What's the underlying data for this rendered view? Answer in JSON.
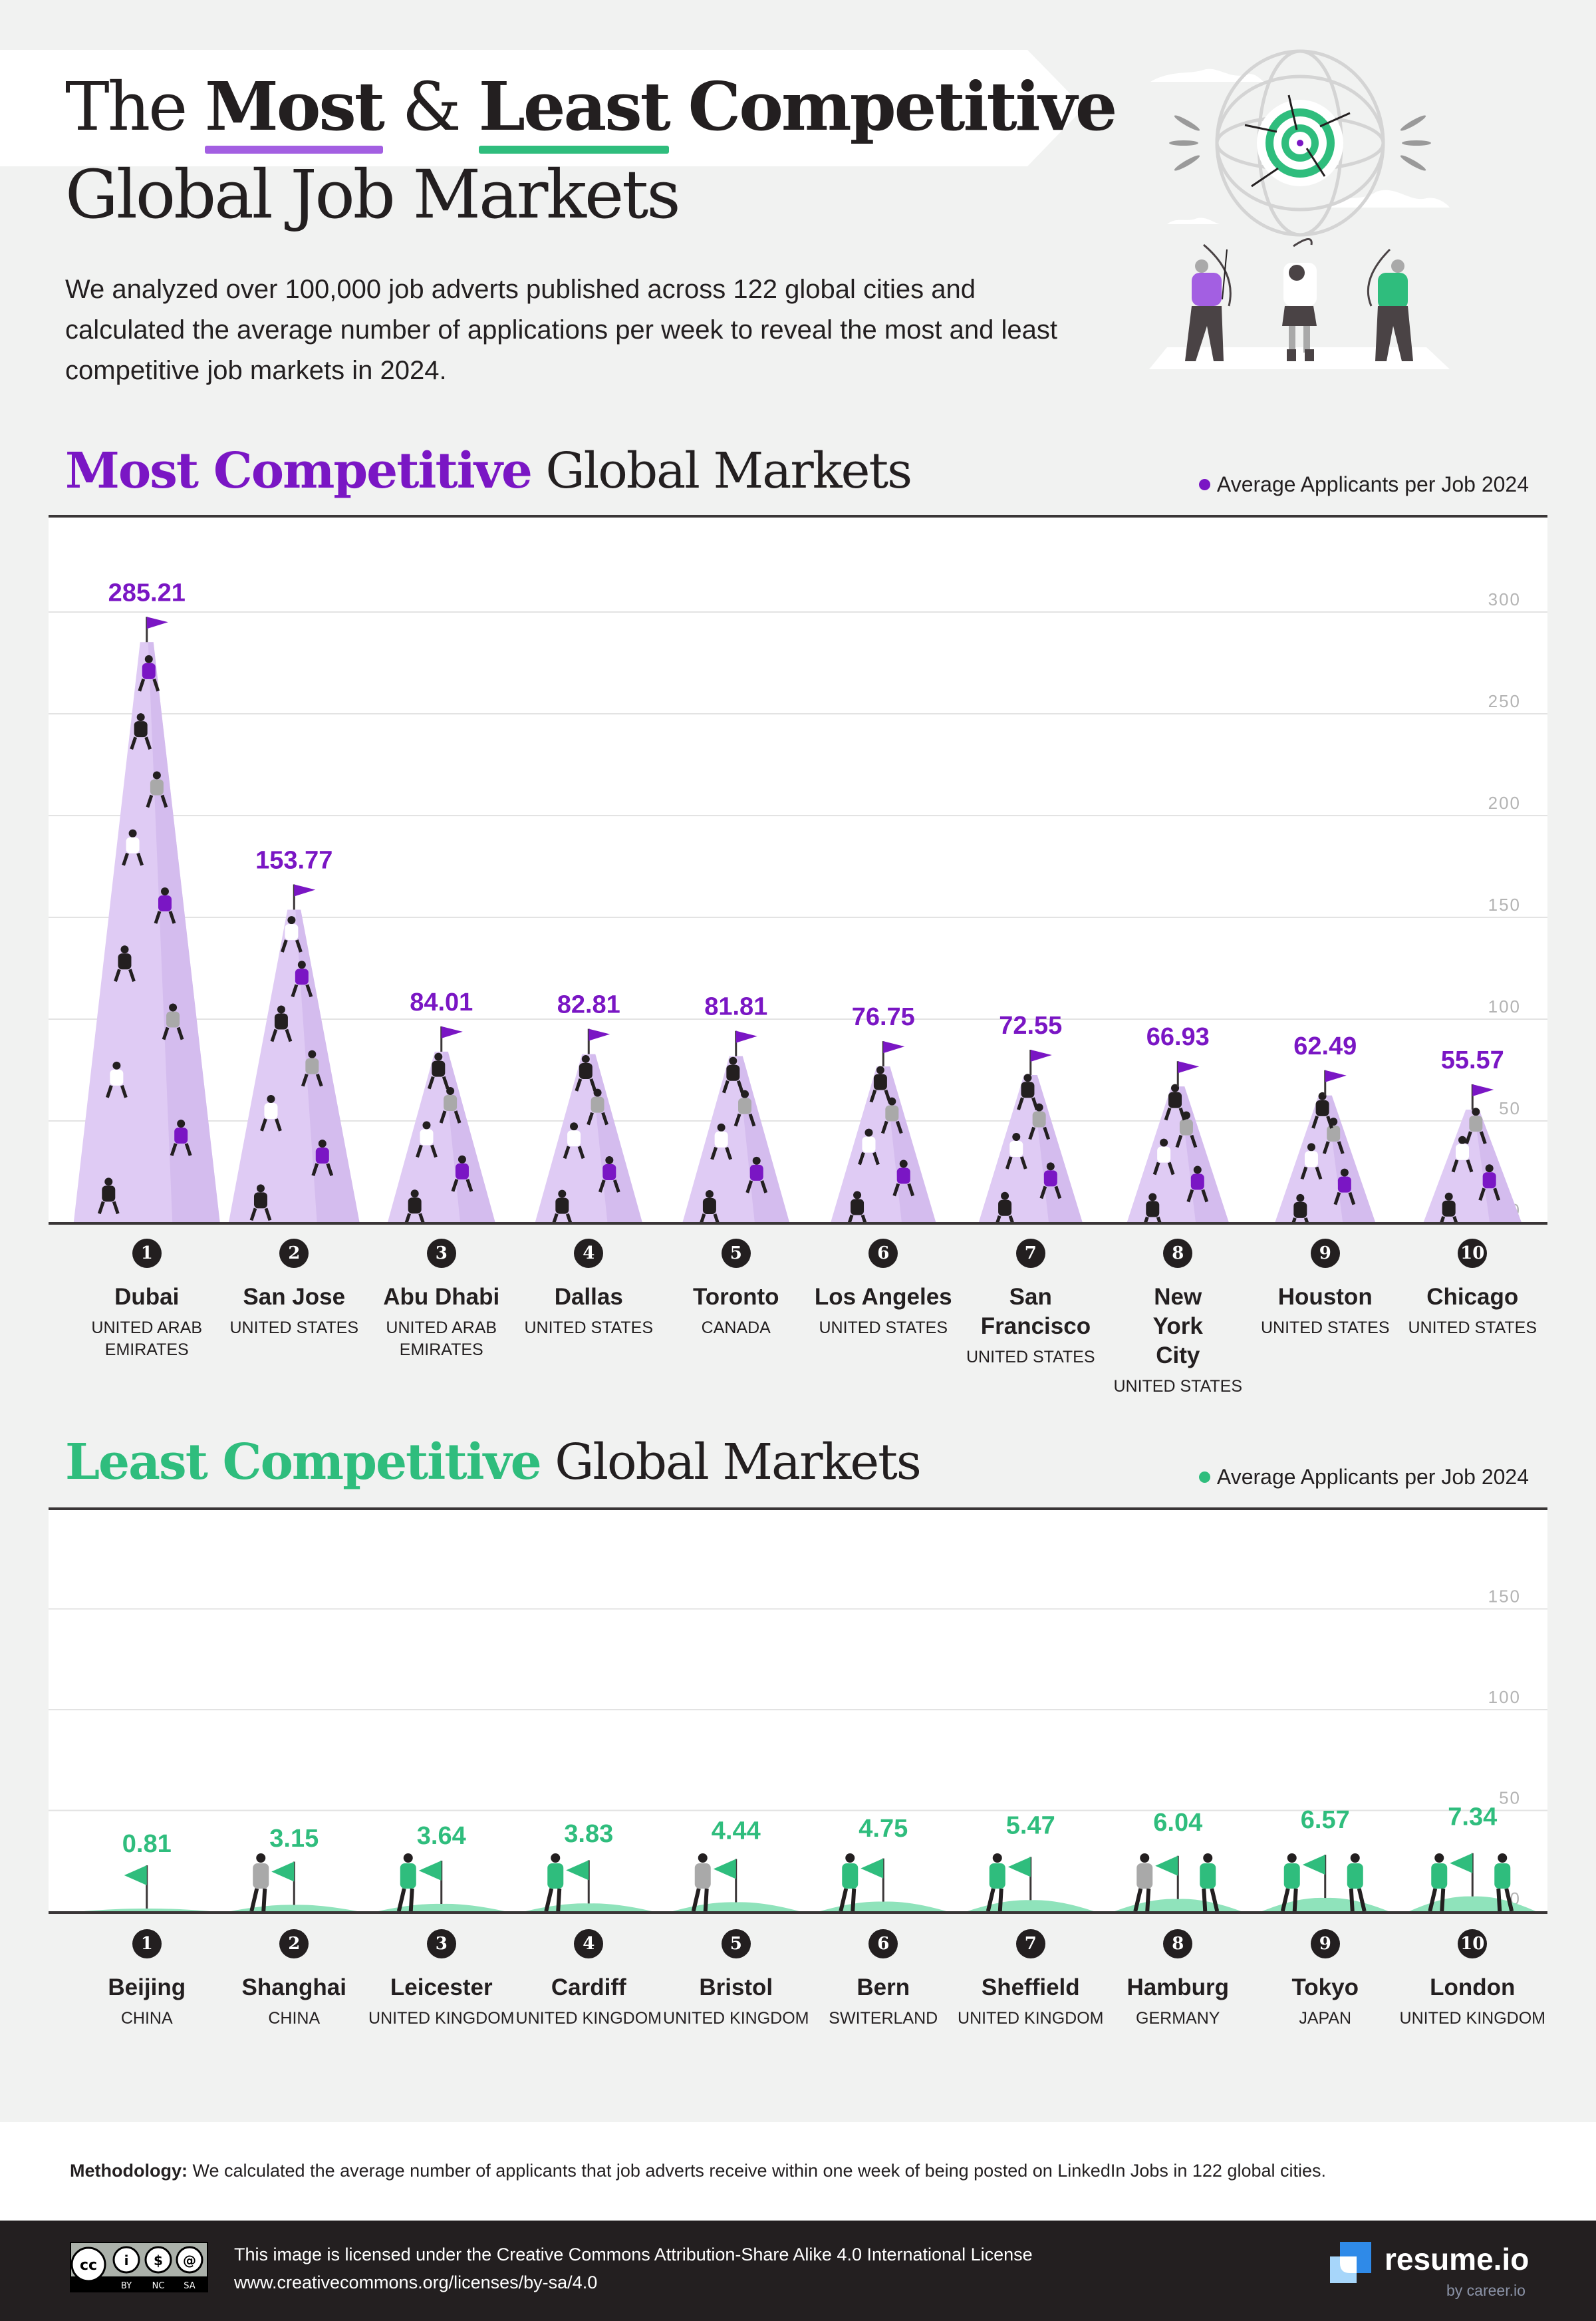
{
  "header": {
    "title_prefix": "The",
    "title_most": "Most",
    "title_amp": "&",
    "title_least": "Least",
    "title_suffix": "Competitive",
    "title_line2": "Global Job Markets",
    "intro": "We analyzed over 100,000 job adverts published across 122 global cities and calculated the average number of applications per week to reveal the most and least competitive job markets in 2024."
  },
  "illustration": {
    "icon": "archers-target-globe-icon",
    "description": "Three archers aiming at a target on a globe"
  },
  "colors": {
    "purple": "#7a16c4",
    "purple_light": "#dfcbf4",
    "green": "#2fbd7d",
    "green_light": "#8fe3bb",
    "dark": "#231f20",
    "background": "#f1f2f1"
  },
  "chart_data": [
    {
      "type": "bar",
      "title_accent": "Most Competitive",
      "title_rest": "Global Markets",
      "legend": "Average Applicants per Job 2024",
      "legend_position": "top-right",
      "ylabel": "",
      "xlabel": "",
      "ylim": [
        0,
        300
      ],
      "yticks": [
        0,
        50,
        100,
        150,
        200,
        250,
        300
      ],
      "grid": true,
      "mark_style": "mountain-with-climbers",
      "categories": [
        {
          "rank": "1",
          "city": "Dubai",
          "country": "UNITED ARAB EMIRATES",
          "value": 285.21,
          "label": "285.21"
        },
        {
          "rank": "2",
          "city": "San Jose",
          "country": "UNITED STATES",
          "value": 153.77,
          "label": "153.77"
        },
        {
          "rank": "3",
          "city": "Abu Dhabi",
          "country": "UNITED ARAB EMIRATES",
          "value": 84.01,
          "label": "84.01"
        },
        {
          "rank": "4",
          "city": "Dallas",
          "country": "UNITED STATES",
          "value": 82.81,
          "label": "82.81"
        },
        {
          "rank": "5",
          "city": "Toronto",
          "country": "CANADA",
          "value": 81.81,
          "label": "81.81"
        },
        {
          "rank": "6",
          "city": "Los Angeles",
          "country": "UNITED STATES",
          "value": 76.75,
          "label": "76.75"
        },
        {
          "rank": "7",
          "city": "San Francisco",
          "country": "UNITED STATES",
          "value": 72.55,
          "label": "72.55"
        },
        {
          "rank": "8",
          "city": "New York City",
          "country": "UNITED STATES",
          "value": 66.93,
          "label": "66.93"
        },
        {
          "rank": "9",
          "city": "Houston",
          "country": "UNITED STATES",
          "value": 62.49,
          "label": "62.49"
        },
        {
          "rank": "10",
          "city": "Chicago",
          "country": "UNITED STATES",
          "value": 55.57,
          "label": "55.57"
        }
      ]
    },
    {
      "type": "bar",
      "title_accent": "Least Competitive",
      "title_rest": "Global Markets",
      "legend": "Average Applicants per Job 2024",
      "legend_position": "top-right",
      "ylabel": "",
      "xlabel": "",
      "ylim": [
        0,
        150
      ],
      "yticks": [
        0,
        50,
        100,
        150
      ],
      "grid": true,
      "mark_style": "hill-with-flag",
      "categories": [
        {
          "rank": "1",
          "city": "Beijing",
          "country": "CHINA",
          "value": 0.81,
          "label": "0.81"
        },
        {
          "rank": "2",
          "city": "Shanghai",
          "country": "CHINA",
          "value": 3.15,
          "label": "3.15"
        },
        {
          "rank": "3",
          "city": "Leicester",
          "country": "UNITED KINGDOM",
          "value": 3.64,
          "label": "3.64"
        },
        {
          "rank": "4",
          "city": "Cardiff",
          "country": "UNITED KINGDOM",
          "value": 3.83,
          "label": "3.83"
        },
        {
          "rank": "5",
          "city": "Bristol",
          "country": "UNITED KINGDOM",
          "value": 4.44,
          "label": "4.44"
        },
        {
          "rank": "6",
          "city": "Bern",
          "country": "SWITERLAND",
          "value": 4.75,
          "label": "4.75"
        },
        {
          "rank": "7",
          "city": "Sheffield",
          "country": "UNITED KINGDOM",
          "value": 5.47,
          "label": "5.47"
        },
        {
          "rank": "8",
          "city": "Hamburg",
          "country": "GERMANY",
          "value": 6.04,
          "label": "6.04"
        },
        {
          "rank": "9",
          "city": "Tokyo",
          "country": "JAPAN",
          "value": 6.57,
          "label": "6.57"
        },
        {
          "rank": "10",
          "city": "London",
          "country": "UNITED KINGDOM",
          "value": 7.34,
          "label": "7.34"
        }
      ]
    }
  ],
  "methodology": {
    "label": "Methodology:",
    "text": " We calculated the average number of applicants that job adverts receive within one week of being posted on LinkedIn Jobs in 122 global cities."
  },
  "footer": {
    "cc_badge": [
      "BY",
      "NC",
      "SA"
    ],
    "license_line1": "This image is licensed under the Creative Commons Attribution-Share Alike 4.0 International License",
    "license_line2": "www.creativecommons.org/licenses/by-sa/4.0",
    "brand": "resume.io",
    "brand_sub": "by career.io"
  }
}
